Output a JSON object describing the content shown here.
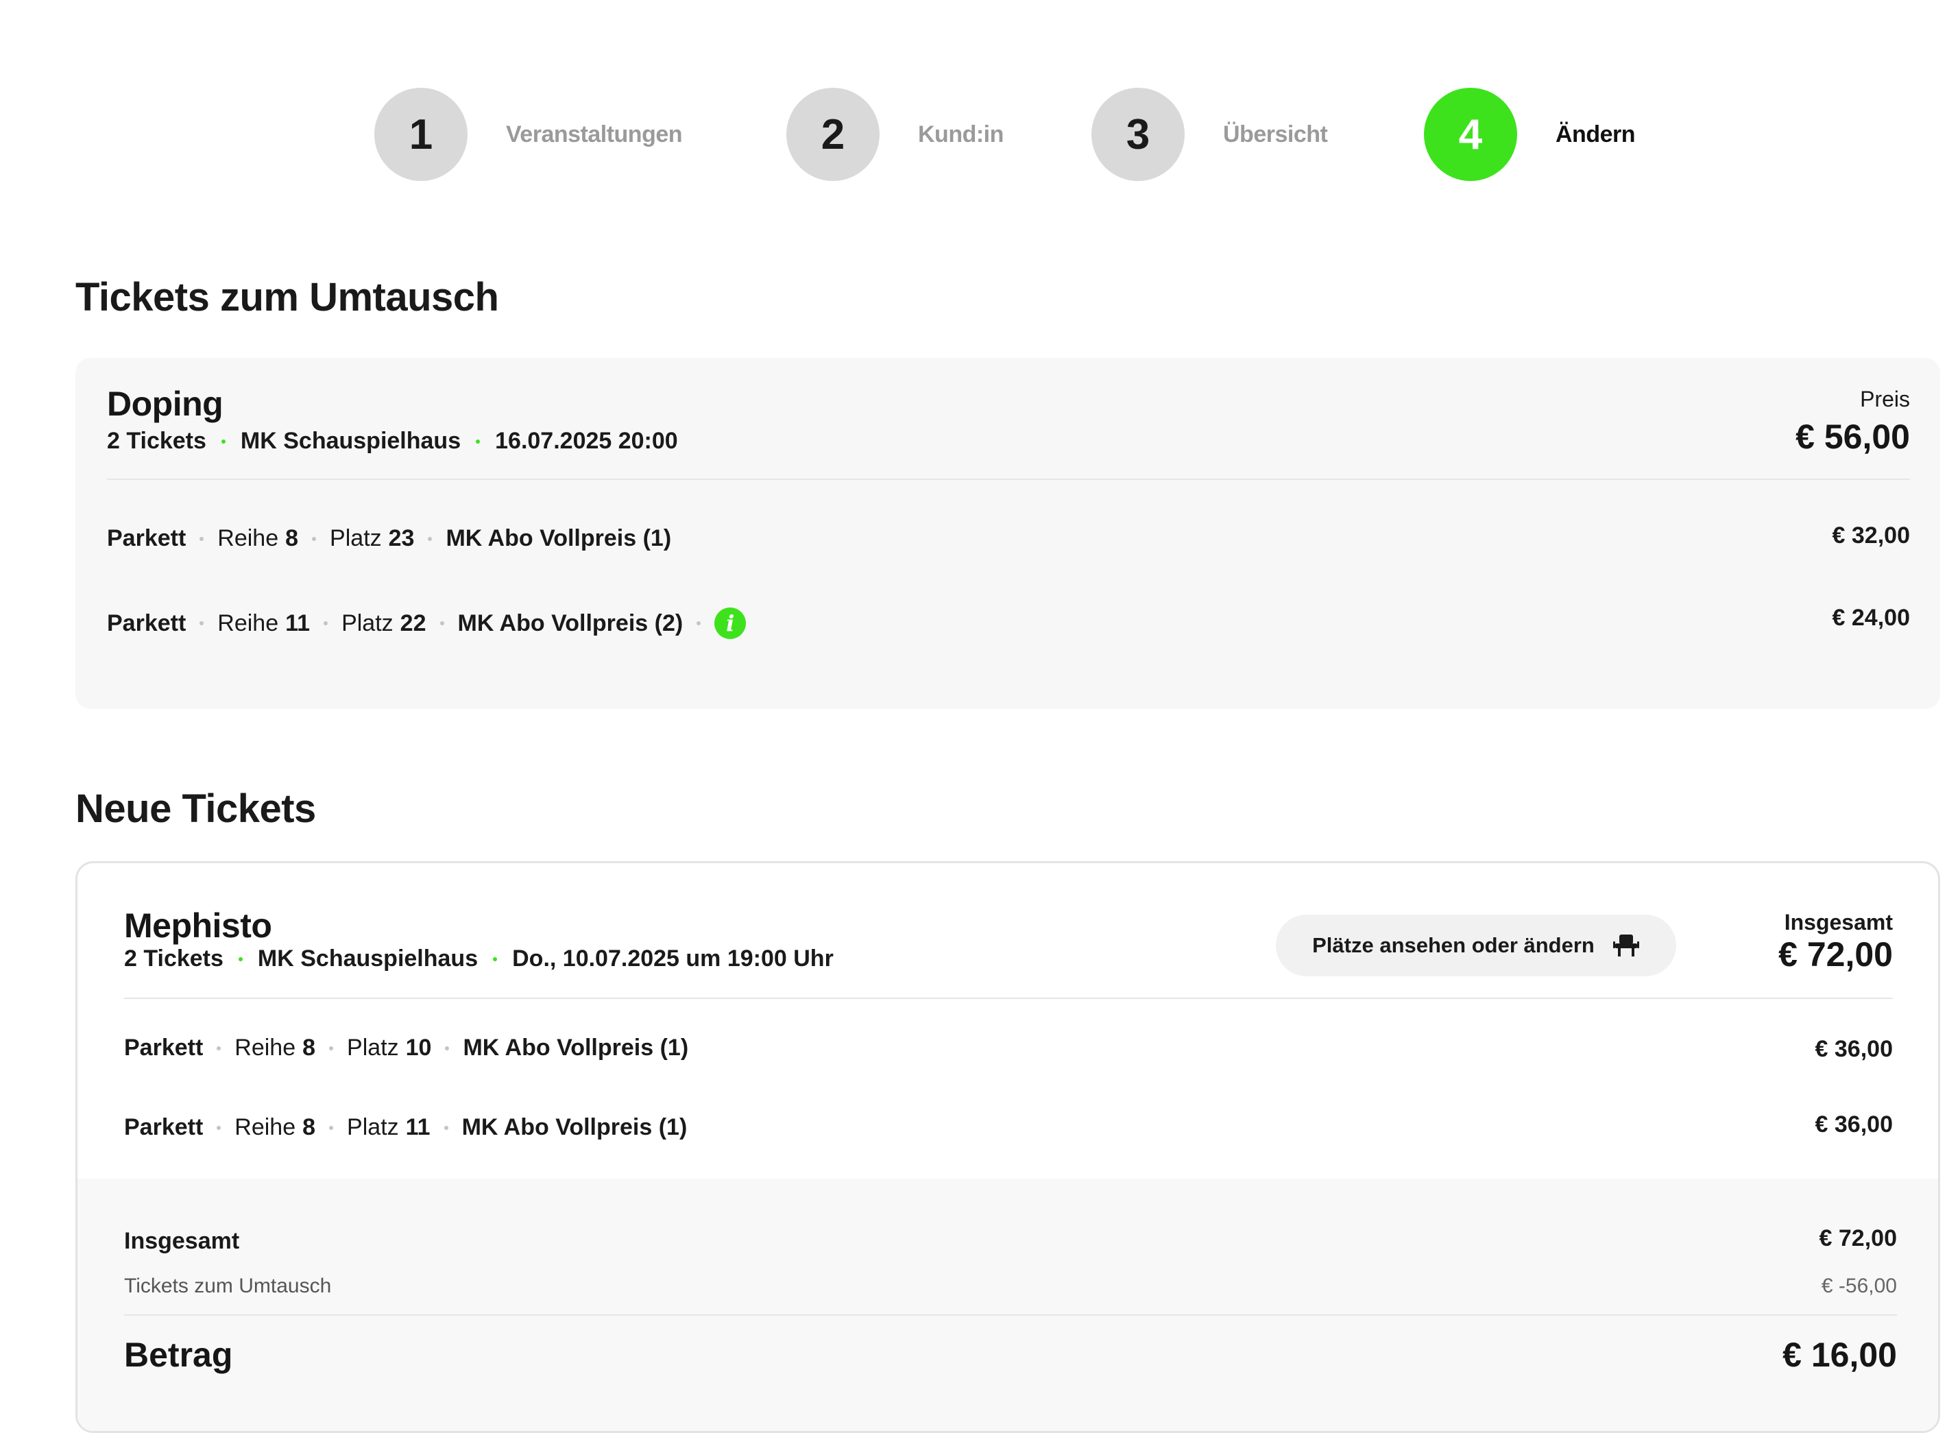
{
  "stepper": {
    "steps": [
      {
        "number": "1",
        "label": "Veranstaltungen",
        "active": false
      },
      {
        "number": "2",
        "label": "Kund:in",
        "active": false
      },
      {
        "number": "3",
        "label": "Übersicht",
        "active": false
      },
      {
        "number": "4",
        "label": "Ändern",
        "active": true
      }
    ]
  },
  "exchange": {
    "heading": "Tickets zum Umtausch",
    "event": {
      "title": "Doping",
      "tickets": "2 Tickets",
      "venue": "MK Schauspielhaus",
      "datetime": "16.07.2025 20:00",
      "price_label": "Preis",
      "price": "€ 56,00"
    },
    "rows": [
      {
        "area": "Parkett",
        "row_label": "Reihe",
        "row": "8",
        "seat_label": "Platz",
        "seat": "23",
        "category": "MK Abo Vollpreis (1)",
        "price": "€ 32,00",
        "info": false
      },
      {
        "area": "Parkett",
        "row_label": "Reihe",
        "row": "11",
        "seat_label": "Platz",
        "seat": "22",
        "category": "MK Abo Vollpreis (2)",
        "price": "€ 24,00",
        "info": true
      }
    ]
  },
  "new_tickets": {
    "heading": "Neue Tickets",
    "event": {
      "title": "Mephisto",
      "tickets": "2 Tickets",
      "venue": "MK Schauspielhaus",
      "datetime": "Do., 10.07.2025 um 19:00 Uhr",
      "seat_button": "Plätze ansehen oder ändern",
      "total_label": "Insgesamt",
      "total": "€ 72,00"
    },
    "rows": [
      {
        "area": "Parkett",
        "row_label": "Reihe",
        "row": "8",
        "seat_label": "Platz",
        "seat": "10",
        "category": "MK Abo Vollpreis (1)",
        "price": "€ 36,00"
      },
      {
        "area": "Parkett",
        "row_label": "Reihe",
        "row": "8",
        "seat_label": "Platz",
        "seat": "11",
        "category": "MK Abo Vollpreis (1)",
        "price": "€ 36,00"
      }
    ],
    "summary": {
      "total_label": "Insgesamt",
      "total_value": "€ 72,00",
      "exchange_label": "Tickets zum Umtausch",
      "exchange_value": "€ -56,00",
      "amount_label": "Betrag",
      "amount_value": "€ 16,00"
    }
  },
  "colors": {
    "accent": "#3de21d",
    "step_inactive": "#d9d9d9"
  }
}
